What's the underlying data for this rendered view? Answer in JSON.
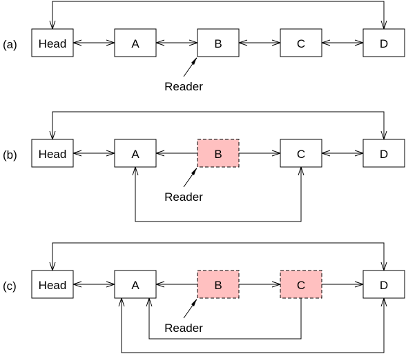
{
  "colors": {
    "normal_fill": "#ffffff",
    "removed_fill": "#ffc0c0",
    "stroke": "#000000"
  },
  "panels": [
    {
      "label": "(a)",
      "reader_label": "Reader",
      "reader_points_to": "B",
      "nodes": [
        {
          "id": "Head",
          "label": "Head",
          "state": "normal"
        },
        {
          "id": "A",
          "label": "A",
          "state": "normal"
        },
        {
          "id": "B",
          "label": "B",
          "state": "normal"
        },
        {
          "id": "C",
          "label": "C",
          "state": "normal"
        },
        {
          "id": "D",
          "label": "D",
          "state": "normal"
        }
      ],
      "edges": [
        {
          "from": "Head",
          "to": "A",
          "type": "bidirectional"
        },
        {
          "from": "A",
          "to": "B",
          "type": "bidirectional"
        },
        {
          "from": "B",
          "to": "C",
          "type": "bidirectional"
        },
        {
          "from": "C",
          "to": "D",
          "type": "bidirectional"
        },
        {
          "from": "Head",
          "to": "D",
          "type": "loop-top-bidirectional"
        }
      ]
    },
    {
      "label": "(b)",
      "reader_label": "Reader",
      "reader_points_to": "B",
      "nodes": [
        {
          "id": "Head",
          "label": "Head",
          "state": "normal"
        },
        {
          "id": "A",
          "label": "A",
          "state": "normal"
        },
        {
          "id": "B",
          "label": "B",
          "state": "removed"
        },
        {
          "id": "C",
          "label": "C",
          "state": "normal"
        },
        {
          "id": "D",
          "label": "D",
          "state": "normal"
        }
      ],
      "edges": [
        {
          "from": "Head",
          "to": "A",
          "type": "bidirectional"
        },
        {
          "from": "B",
          "to": "A",
          "type": "forward"
        },
        {
          "from": "B",
          "to": "C",
          "type": "forward"
        },
        {
          "from": "C",
          "to": "D",
          "type": "bidirectional"
        },
        {
          "from": "Head",
          "to": "D",
          "type": "loop-top-bidirectional"
        },
        {
          "from": "A",
          "to": "C",
          "type": "loop-bottom-bidirectional"
        }
      ]
    },
    {
      "label": "(c)",
      "reader_label": "Reader",
      "reader_points_to": "B",
      "nodes": [
        {
          "id": "Head",
          "label": "Head",
          "state": "normal"
        },
        {
          "id": "A",
          "label": "A",
          "state": "normal"
        },
        {
          "id": "B",
          "label": "B",
          "state": "removed"
        },
        {
          "id": "C",
          "label": "C",
          "state": "removed"
        },
        {
          "id": "D",
          "label": "D",
          "state": "normal"
        }
      ],
      "edges": [
        {
          "from": "Head",
          "to": "A",
          "type": "bidirectional"
        },
        {
          "from": "B",
          "to": "A",
          "type": "forward"
        },
        {
          "from": "B",
          "to": "C",
          "type": "forward"
        },
        {
          "from": "C",
          "to": "D",
          "type": "forward"
        },
        {
          "from": "Head",
          "to": "D",
          "type": "loop-top-bidirectional"
        },
        {
          "from": "C",
          "to": "A",
          "type": "loop-bottom-forward"
        },
        {
          "from": "A",
          "to": "D",
          "type": "loop-bottom-bidirectional"
        }
      ]
    }
  ]
}
